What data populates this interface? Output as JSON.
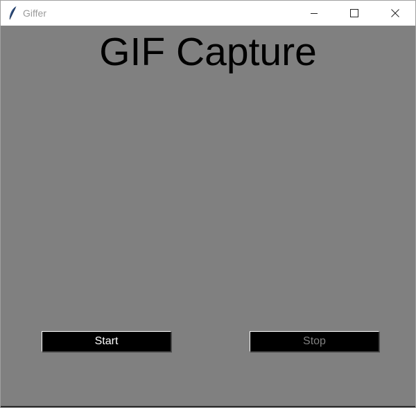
{
  "window": {
    "title": "Giffer",
    "app_icon": "feather-icon",
    "controls": {
      "minimize_icon": "minimize-icon",
      "maximize_icon": "maximize-icon",
      "close_icon": "close-icon"
    }
  },
  "main": {
    "heading": "GIF Capture",
    "start_label": "Start",
    "stop_label": "Stop",
    "stop_disabled": true
  },
  "colors": {
    "background": "#808080",
    "button_bg": "#000000",
    "start_text": "#ffffff",
    "stop_text_disabled": "#808080",
    "heading_text": "#000000"
  }
}
